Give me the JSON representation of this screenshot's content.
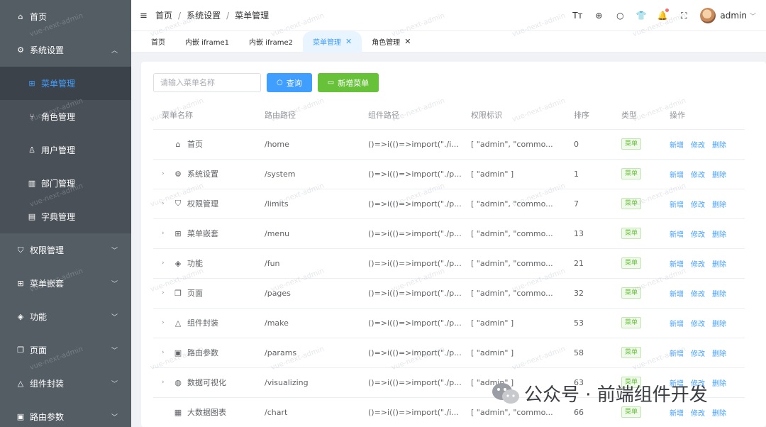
{
  "sidebar": {
    "items": [
      {
        "label": "首页",
        "icon": "home-icon"
      },
      {
        "label": "系统设置",
        "icon": "gear-icon",
        "expanded": true
      },
      {
        "label": "权限管理",
        "icon": "shield-icon"
      },
      {
        "label": "菜单嵌套",
        "icon": "grid-icon"
      },
      {
        "label": "功能",
        "icon": "cube-icon"
      },
      {
        "label": "页面",
        "icon": "copy-icon"
      },
      {
        "label": "组件封装",
        "icon": "shapes-icon"
      },
      {
        "label": "路由参数",
        "icon": "image-icon"
      }
    ],
    "sub_items": [
      {
        "label": "菜单管理",
        "icon": "grid-icon",
        "active": true
      },
      {
        "label": "角色管理",
        "icon": "role-icon"
      },
      {
        "label": "用户管理",
        "icon": "user-icon"
      },
      {
        "label": "部门管理",
        "icon": "department-icon"
      },
      {
        "label": "字典管理",
        "icon": "dictionary-icon"
      }
    ]
  },
  "header": {
    "breadcrumb": [
      "首页",
      "系统设置",
      "菜单管理"
    ],
    "separator": "/",
    "username": "admin"
  },
  "tags": [
    "首页",
    "内嵌 iframe1",
    "内嵌 iframe2",
    "菜单管理",
    "角色管理"
  ],
  "toolbar": {
    "search_placeholder": "请输入菜单名称",
    "query_label": "查询",
    "add_label": "新增菜单"
  },
  "table": {
    "headers": [
      "菜单名称",
      "路由路径",
      "组件路径",
      "权限标识",
      "排序",
      "类型",
      "操作"
    ],
    "rows": [
      {
        "name": "首页",
        "path": "/home",
        "component": "()=>i(()=>import(\"./i...",
        "perm": "[ \"admin\", \"commo...",
        "sort": "0",
        "type": "菜单",
        "expandable": false
      },
      {
        "name": "系统设置",
        "path": "/system",
        "component": "()=>i(()=>import(\"./p...",
        "perm": "[ \"admin\" ]",
        "sort": "1",
        "type": "菜单",
        "expandable": true
      },
      {
        "name": "权限管理",
        "path": "/limits",
        "component": "()=>i(()=>import(\"./p...",
        "perm": "[ \"admin\", \"commo...",
        "sort": "7",
        "type": "菜单",
        "expandable": true
      },
      {
        "name": "菜单嵌套",
        "path": "/menu",
        "component": "()=>i(()=>import(\"./p...",
        "perm": "[ \"admin\", \"commo...",
        "sort": "13",
        "type": "菜单",
        "expandable": true
      },
      {
        "name": "功能",
        "path": "/fun",
        "component": "()=>i(()=>import(\"./p...",
        "perm": "[ \"admin\", \"commo...",
        "sort": "21",
        "type": "菜单",
        "expandable": true
      },
      {
        "name": "页面",
        "path": "/pages",
        "component": "()=>i(()=>import(\"./p...",
        "perm": "[ \"admin\", \"commo...",
        "sort": "32",
        "type": "菜单",
        "expandable": true
      },
      {
        "name": "组件封装",
        "path": "/make",
        "component": "()=>i(()=>import(\"./p...",
        "perm": "[ \"admin\" ]",
        "sort": "53",
        "type": "菜单",
        "expandable": true
      },
      {
        "name": "路由参数",
        "path": "/params",
        "component": "()=>i(()=>import(\"./p...",
        "perm": "[ \"admin\" ]",
        "sort": "58",
        "type": "菜单",
        "expandable": true
      },
      {
        "name": "数据可视化",
        "path": "/visualizing",
        "component": "()=>i(()=>import(\"./p...",
        "perm": "[ \"admin\" ]",
        "sort": "63",
        "type": "菜单",
        "expandable": true
      },
      {
        "name": "大数据图表",
        "path": "/chart",
        "component": "()=>i(()=>import(\"./i...",
        "perm": "[ \"admin\", \"commo...",
        "sort": "66",
        "type": "菜单",
        "expandable": false
      }
    ],
    "actions": [
      "新增",
      "修改",
      "删除"
    ]
  },
  "watermark_text": "vue-next-admin",
  "overlay_text": "公众号 · 前端组件开发",
  "colors": {
    "sidebar_bg": "#545c64",
    "primary": "#409eff",
    "success": "#67c23a"
  }
}
